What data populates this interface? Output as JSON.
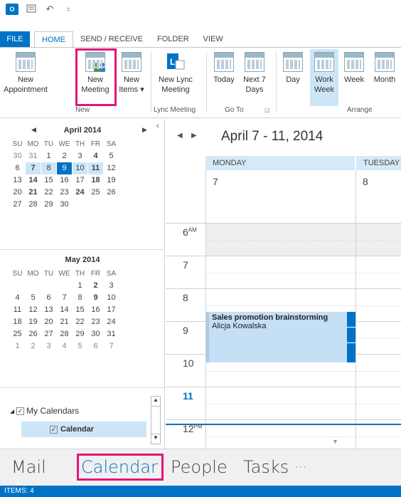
{
  "quick_access": {
    "undo_icon": "↶",
    "more_icon": "⩡"
  },
  "tabs": [
    "FILE",
    "HOME",
    "SEND / RECEIVE",
    "FOLDER",
    "VIEW"
  ],
  "ribbon": {
    "new_appointment": "New\nAppointment",
    "new_appointment_l1": "New",
    "new_appointment_l2": "Appointment",
    "new_meeting_l1": "New",
    "new_meeting_l2": "Meeting",
    "new_items_l1": "New",
    "new_items_l2": "Items ▾",
    "new_lync_l1": "New Lync",
    "new_lync_l2": "Meeting",
    "today": "Today",
    "next7_l1": "Next 7",
    "next7_l2": "Days",
    "day": "Day",
    "work_week_l1": "Work",
    "work_week_l2": "Week",
    "week": "Week",
    "month": "Month",
    "group_new": "New",
    "group_lync": "Lync Meeting",
    "group_goto": "Go To",
    "group_arrange": "Arrange"
  },
  "mini_cal_april": {
    "title": "April 2014",
    "dow": [
      "SU",
      "MO",
      "TU",
      "WE",
      "TH",
      "FR",
      "SA"
    ],
    "weeks": [
      [
        "30",
        "31",
        "1",
        "2",
        "3",
        "4",
        "5"
      ],
      [
        "6",
        "7",
        "8",
        "9",
        "10",
        "11",
        "12"
      ],
      [
        "13",
        "14",
        "15",
        "16",
        "17",
        "18",
        "19"
      ],
      [
        "20",
        "21",
        "22",
        "23",
        "24",
        "25",
        "26"
      ],
      [
        "27",
        "28",
        "29",
        "30",
        "",
        "",
        ""
      ]
    ]
  },
  "mini_cal_may": {
    "title": "May 2014",
    "dow": [
      "SU",
      "MO",
      "TU",
      "WE",
      "TH",
      "FR",
      "SA"
    ],
    "weeks": [
      [
        "",
        "",
        "",
        "",
        "1",
        "2",
        "3"
      ],
      [
        "4",
        "5",
        "6",
        "7",
        "8",
        "9",
        "10"
      ],
      [
        "11",
        "12",
        "13",
        "14",
        "15",
        "16",
        "17"
      ],
      [
        "18",
        "19",
        "20",
        "21",
        "22",
        "23",
        "24"
      ],
      [
        "25",
        "26",
        "27",
        "28",
        "29",
        "30",
        "31"
      ],
      [
        "1",
        "2",
        "3",
        "4",
        "5",
        "6",
        "7"
      ]
    ]
  },
  "folders": {
    "my_calendars": "My Calendars",
    "calendar": "Calendar"
  },
  "calendar": {
    "range_title": "April 7 - 11, 2014",
    "days": [
      {
        "name": "MONDAY",
        "num": "7"
      },
      {
        "name": "TUESDAY",
        "num": "8"
      }
    ],
    "times": [
      {
        "hour": "6",
        "ampm": "AM"
      },
      {
        "hour": "7",
        "ampm": ""
      },
      {
        "hour": "8",
        "ampm": ""
      },
      {
        "hour": "9",
        "ampm": ""
      },
      {
        "hour": "10",
        "ampm": ""
      },
      {
        "hour": "11",
        "ampm": ""
      },
      {
        "hour": "12",
        "ampm": "PM"
      }
    ],
    "appointment": {
      "subject": "Sales promotion brainstorming",
      "organizer": "Alicja Kowalska"
    }
  },
  "bottom_nav": {
    "mail": "Mail",
    "calendar": "Calendar",
    "people": "People",
    "tasks": "Tasks",
    "more": "···"
  },
  "status": {
    "items": "ITEMS: 4"
  },
  "colors": {
    "accent": "#0072c6",
    "highlight": "#e0177b",
    "appointment": "#c5dff5"
  }
}
